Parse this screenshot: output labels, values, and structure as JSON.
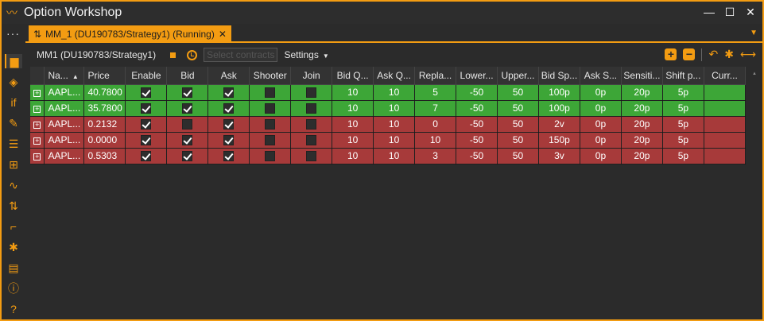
{
  "window": {
    "title": "Option Workshop"
  },
  "tab": {
    "label": "MM_1 (DU190783/Strategy1) (Running)",
    "close": "✕"
  },
  "toolbar": {
    "strategy": "MM1 (DU190783/Strategy1)",
    "select_contracts": "Select contracts",
    "settings": "Settings"
  },
  "columns": [
    "Na...",
    "Price",
    "Enable",
    "Bid",
    "Ask",
    "Shooter",
    "Join",
    "Bid Q...",
    "Ask Q...",
    "Repla...",
    "Lower...",
    "Upper...",
    "Bid Sp...",
    "Ask S...",
    "Sensiti...",
    "Shift p...",
    "Curr..."
  ],
  "rows": [
    {
      "status": "green",
      "name": "AAPL...",
      "price": "40.7800",
      "enable": true,
      "bid": true,
      "ask": true,
      "shooter": false,
      "join": false,
      "bidq": "10",
      "askq": "10",
      "replace": "5",
      "lower": "-50",
      "upper": "50",
      "bidsp": "100p",
      "asks": "0p",
      "sens": "20p",
      "shift": "5p",
      "curr": ""
    },
    {
      "status": "green",
      "name": "AAPL...",
      "price": "35.7800",
      "enable": true,
      "bid": true,
      "ask": true,
      "shooter": false,
      "join": false,
      "bidq": "10",
      "askq": "10",
      "replace": "7",
      "lower": "-50",
      "upper": "50",
      "bidsp": "100p",
      "asks": "0p",
      "sens": "20p",
      "shift": "5p",
      "curr": ""
    },
    {
      "status": "red",
      "name": "AAPL...",
      "price": "0.2132",
      "enable": true,
      "bid": false,
      "ask": true,
      "shooter": false,
      "join": false,
      "bidq": "10",
      "askq": "10",
      "replace": "0",
      "lower": "-50",
      "upper": "50",
      "bidsp": "2v",
      "asks": "0p",
      "sens": "20p",
      "shift": "5p",
      "curr": ""
    },
    {
      "status": "red",
      "name": "AAPL...",
      "price": "0.0000",
      "enable": true,
      "bid": true,
      "ask": true,
      "shooter": false,
      "join": false,
      "bidq": "10",
      "askq": "10",
      "replace": "10",
      "lower": "-50",
      "upper": "50",
      "bidsp": "150p",
      "asks": "0p",
      "sens": "20p",
      "shift": "5p",
      "curr": ""
    },
    {
      "status": "red",
      "name": "AAPL...",
      "price": "0.5303",
      "enable": true,
      "bid": true,
      "ask": true,
      "shooter": false,
      "join": false,
      "bidq": "10",
      "askq": "10",
      "replace": "3",
      "lower": "-50",
      "upper": "50",
      "bidsp": "3v",
      "asks": "0p",
      "sens": "20p",
      "shift": "5p",
      "curr": ""
    }
  ],
  "colors": {
    "accent": "#f39c12",
    "row_green": "#3da637",
    "row_red": "#a73a3a",
    "background": "#2b2b2b"
  },
  "icons": [
    "briefcase-icon",
    "tag-icon",
    "if-icon",
    "edit-chart-icon",
    "list-icon",
    "cart-icon",
    "bell-curve-icon",
    "sort-icon",
    "steps-icon",
    "gear-icon",
    "document-icon",
    "info-icon",
    "help-icon"
  ]
}
